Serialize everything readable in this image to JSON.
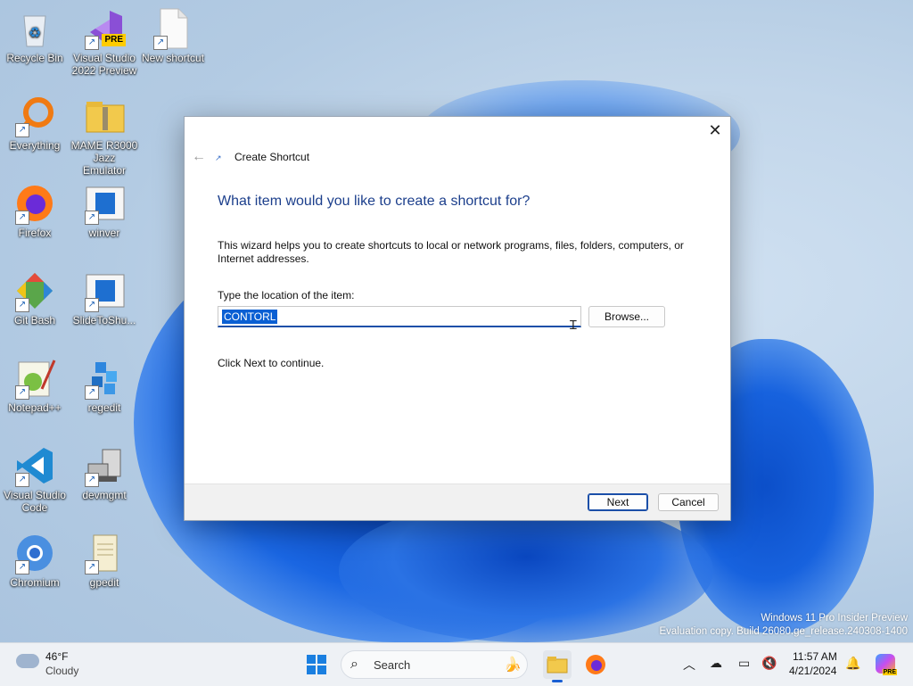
{
  "desktop": {
    "icons": [
      {
        "label": "Recycle Bin"
      },
      {
        "label": "Visual Studio 2022 Preview",
        "badge": "PRE"
      },
      {
        "label": "New shortcut"
      },
      {
        "label": "Everything"
      },
      {
        "label": "MAME R3000 Jazz Emulator"
      },
      {
        "label": "Firefox"
      },
      {
        "label": "winver"
      },
      {
        "label": "Git Bash"
      },
      {
        "label": "SlideToShu..."
      },
      {
        "label": "Notepad++"
      },
      {
        "label": "regedit"
      },
      {
        "label": "Visual Studio Code"
      },
      {
        "label": "devmgmt"
      },
      {
        "label": "Chromium"
      },
      {
        "label": "gpedit"
      }
    ]
  },
  "dialog": {
    "title": "Create Shortcut",
    "close_glyph": "✕",
    "back_glyph": "←",
    "heading": "What item would you like to create a shortcut for?",
    "description": "This wizard helps you to create shortcuts to local or network programs, files, folders, computers, or Internet addresses.",
    "location_label": "Type the location of the item:",
    "location_value": "CONTORL",
    "browse_label": "Browse...",
    "hint": "Click Next to continue.",
    "next_label": "Next",
    "cancel_label": "Cancel"
  },
  "watermark": {
    "line1": "Windows 11 Pro Insider Preview",
    "line2": "Evaluation copy. Build 26080.ge_release.240308-1400"
  },
  "taskbar": {
    "weather_temp": "46°F",
    "weather_condition": "Cloudy",
    "search_placeholder": "Search",
    "clock_time": "11:57 AM",
    "clock_date": "4/21/2024",
    "copilot_badge": "PRE"
  },
  "colors": {
    "accent": "#1b4fa8",
    "heading": "#1c3f8c",
    "selection": "#0a5fd3"
  }
}
